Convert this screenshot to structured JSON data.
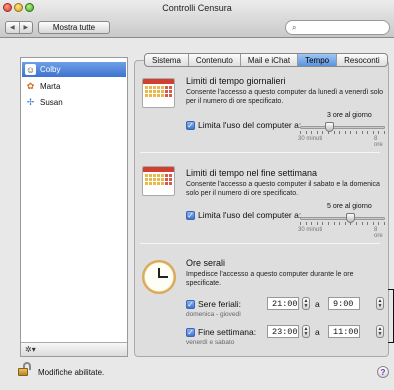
{
  "window": {
    "title": "Controlli Censura"
  },
  "toolbar": {
    "show_all_label": "Mostra tutte",
    "back_glyph": "◀",
    "forward_glyph": "▶",
    "search_glyph": "⌕"
  },
  "sidebar": {
    "users": [
      {
        "name": "Colby",
        "icon": "robot-icon",
        "glyph": "☺",
        "selected": true
      },
      {
        "name": "Marta",
        "icon": "butterfly-icon",
        "glyph": "✿",
        "selected": false
      },
      {
        "name": "Susan",
        "icon": "dragonfly-icon",
        "glyph": "✢",
        "selected": false
      }
    ],
    "action_glyph": "✲▾"
  },
  "tabs": [
    {
      "label": "Sistema",
      "active": false
    },
    {
      "label": "Contenuto",
      "active": false
    },
    {
      "label": "Mail e iChat",
      "active": false
    },
    {
      "label": "Tempo",
      "active": true
    },
    {
      "label": "Resoconti",
      "active": false
    }
  ],
  "weekday": {
    "title": "Limiti di tempo giornalieri",
    "description": "Consente l'accesso a questo computer da lunedì a venerdì solo per il numero di ore specificato.",
    "checkbox_label": "Limita l'uso del computer a:",
    "checked": true,
    "slider_caption": "3 ore al giorno",
    "slider_min": "30 minuti",
    "slider_max": "8 ore",
    "slider_value_fraction": 0.33
  },
  "weekend": {
    "title": "Limiti di tempo nel fine settimana",
    "description": "Consente l'accesso a questo computer il sabato e la domenica solo per il numero di ore specificato.",
    "checkbox_label": "Limita l'uso del computer a:",
    "checked": true,
    "slider_caption": "5 ore al giorno",
    "slider_min": "30 minuti",
    "slider_max": "8 ore",
    "slider_value_fraction": 0.6
  },
  "bedtime": {
    "title": "Ore serali",
    "description": "Impedisce l'accesso a questo computer durante le ore specificate.",
    "school_nights": {
      "label": "Sere feriali:",
      "sub": "domenica - giovedì",
      "from": "21:00",
      "to": "9:00",
      "checked": true
    },
    "weekend": {
      "label": "Fine settimana:",
      "sub": "venerdì e sabato",
      "from": "23:00",
      "to": "11:00",
      "checked": true
    },
    "separator": "a"
  },
  "footer": {
    "lock_label": "Modifiche abilitate.",
    "help_glyph": "?"
  }
}
